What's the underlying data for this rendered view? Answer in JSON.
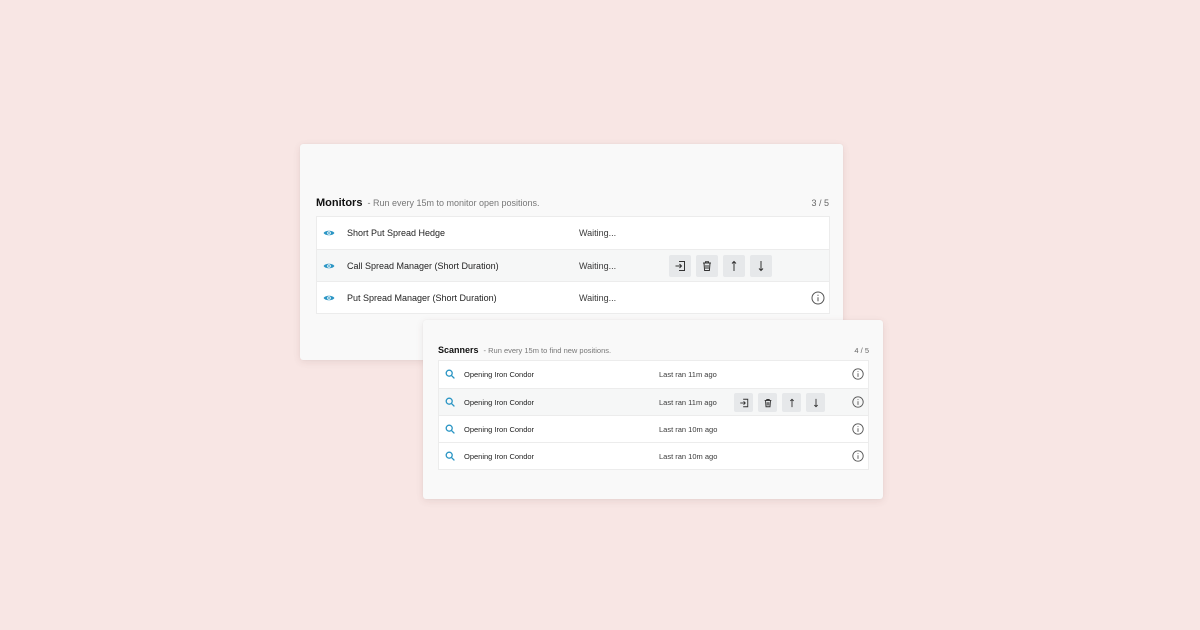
{
  "colors": {
    "background": "#f8e6e4",
    "accent": "#2a95c4",
    "button_bg": "#e6e8ea"
  },
  "monitors": {
    "title": "Monitors",
    "subtitle": "- Run every 15m to monitor open positions.",
    "count": "3 / 5",
    "rows": [
      {
        "icon": "eye-icon",
        "name": "Short Put Spread Hedge",
        "status": "Waiting..."
      },
      {
        "icon": "eye-icon",
        "name": "Call Spread Manager (Short Duration)",
        "status": "Waiting..."
      },
      {
        "icon": "eye-icon",
        "name": "Put Spread Manager (Short Duration)",
        "status": "Waiting..."
      }
    ]
  },
  "scanners": {
    "title": "Scanners",
    "subtitle": "- Run every 15m to find new positions.",
    "count": "4 / 5",
    "rows": [
      {
        "icon": "search-icon",
        "name": "Opening Iron Condor",
        "status": "Last ran 11m ago"
      },
      {
        "icon": "search-icon",
        "name": "Opening Iron Condor",
        "status": "Last ran 11m ago"
      },
      {
        "icon": "search-icon",
        "name": "Opening Iron Condor",
        "status": "Last ran 10m ago"
      },
      {
        "icon": "search-icon",
        "name": "Opening Iron Condor",
        "status": "Last ran 10m ago"
      }
    ]
  },
  "row_actions": [
    "open-icon",
    "trash-icon",
    "move-up-icon",
    "move-down-icon"
  ]
}
